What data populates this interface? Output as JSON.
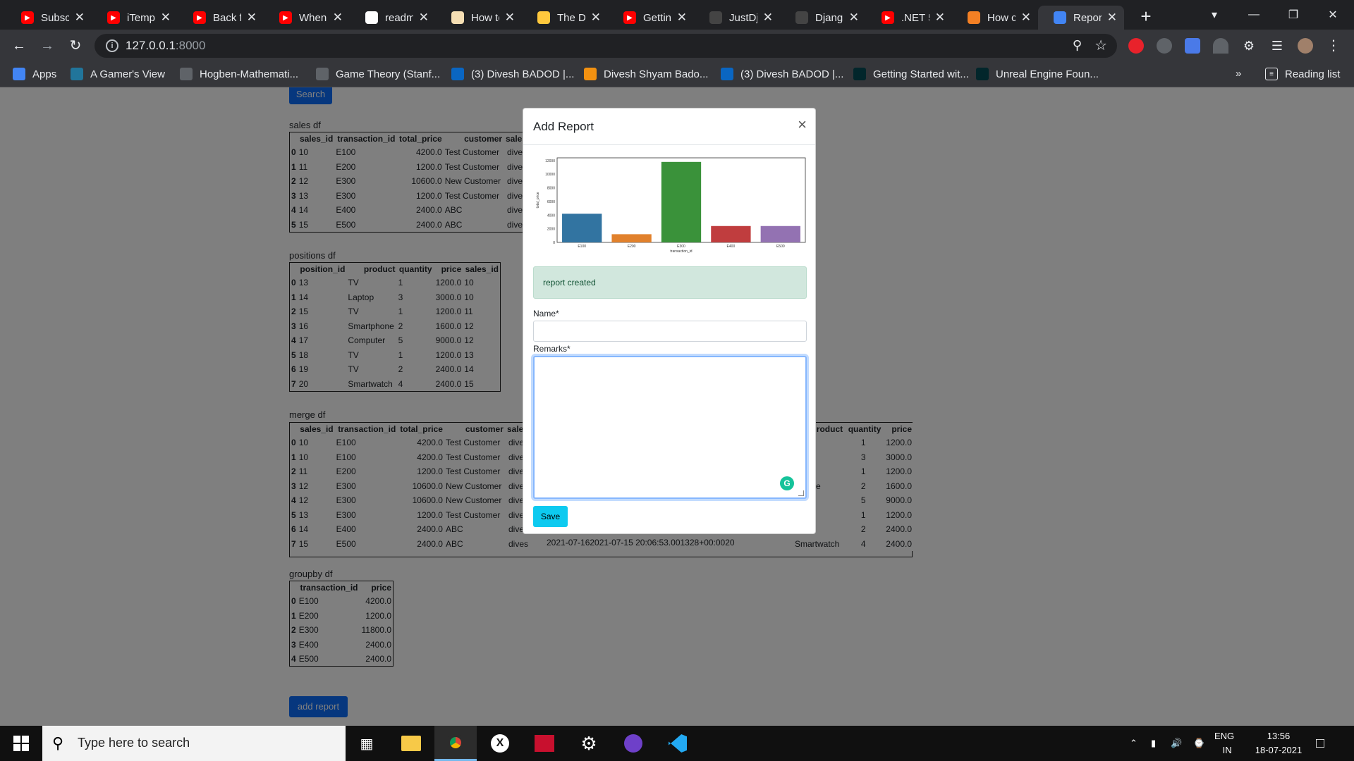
{
  "browser": {
    "tabs": [
      {
        "title": "Subscr",
        "icon": "youtube-icon",
        "color": "#ff0000"
      },
      {
        "title": "iTemp",
        "icon": "youtube-icon",
        "color": "#ff0000"
      },
      {
        "title": "Back fr",
        "icon": "youtube-icon",
        "color": "#ff0000"
      },
      {
        "title": "When",
        "icon": "youtube-icon",
        "color": "#ff0000"
      },
      {
        "title": "readm",
        "icon": "google-icon",
        "color": "#ffffff"
      },
      {
        "title": "How to",
        "icon": "howto-icon",
        "color": "#f5deb3"
      },
      {
        "title": "The D",
        "icon": "emoji-icon",
        "color": "#ffc83d"
      },
      {
        "title": "Gettin",
        "icon": "youtube-icon",
        "color": "#ff0000"
      },
      {
        "title": "JustDj",
        "icon": "github-icon",
        "color": "#444444"
      },
      {
        "title": "Djang",
        "icon": "github-icon",
        "color": "#444444"
      },
      {
        "title": ".NET 5",
        "icon": "youtube-icon",
        "color": "#ff0000"
      },
      {
        "title": "How c",
        "icon": "stackoverflow-icon",
        "color": "#f48024"
      },
      {
        "title": "Repor",
        "icon": "tab-logo-icon",
        "color": "#4285f4",
        "active": true
      }
    ],
    "url_host": "127.0.0.1",
    "url_port": ":8000",
    "bookmarks": [
      {
        "label": "Apps",
        "icon": "apps-grid-icon"
      },
      {
        "label": "A Gamer's View",
        "icon": "wordpress-icon"
      },
      {
        "label": "Hogben-Mathemati...",
        "icon": "library-icon"
      },
      {
        "label": "Game Theory (Stanf...",
        "icon": "coursera-icon"
      },
      {
        "label": "(3) Divesh BADOD |...",
        "icon": "linkedin-icon"
      },
      {
        "label": "Divesh Shyam Bado...",
        "icon": "profile-icon"
      },
      {
        "label": "(3) Divesh BADOD |...",
        "icon": "linkedin-icon"
      },
      {
        "label": "Getting Started wit...",
        "icon": "edx-icon"
      },
      {
        "label": "Unreal Engine Foun...",
        "icon": "edx-icon"
      }
    ],
    "bookmarks_overflow": "»",
    "reading_list": "Reading list"
  },
  "page": {
    "search_button": "Search",
    "sales_label": "sales df",
    "sales_table": {
      "headers": [
        "",
        "sales_id",
        "transaction_id",
        "total_price",
        "customer",
        "sales"
      ],
      "rows": [
        [
          "0",
          "10",
          "E100",
          "4200.0",
          "Test Customer",
          "dives"
        ],
        [
          "1",
          "11",
          "E200",
          "1200.0",
          "Test Customer",
          "dives"
        ],
        [
          "2",
          "12",
          "E300",
          "10600.0",
          "New Customer",
          "dives"
        ],
        [
          "3",
          "13",
          "E300",
          "1200.0",
          "Test Customer",
          "dives"
        ],
        [
          "4",
          "14",
          "E400",
          "2400.0",
          "ABC",
          "dives"
        ],
        [
          "5",
          "15",
          "E500",
          "2400.0",
          "ABC",
          "dives"
        ]
      ]
    },
    "positions_label": "positions df",
    "positions_table": {
      "headers": [
        "",
        "position_id",
        "product",
        "quantity",
        "price",
        "sales_id"
      ],
      "rows": [
        [
          "0",
          "13",
          "TV",
          "1",
          "1200.0",
          "10"
        ],
        [
          "1",
          "14",
          "Laptop",
          "3",
          "3000.0",
          "10"
        ],
        [
          "2",
          "15",
          "TV",
          "1",
          "1200.0",
          "11"
        ],
        [
          "3",
          "16",
          "Smartphone",
          "2",
          "1600.0",
          "12"
        ],
        [
          "4",
          "17",
          "Computer",
          "5",
          "9000.0",
          "12"
        ],
        [
          "5",
          "18",
          "TV",
          "1",
          "1200.0",
          "13"
        ],
        [
          "6",
          "19",
          "TV",
          "2",
          "2400.0",
          "14"
        ],
        [
          "7",
          "20",
          "Smartwatch",
          "4",
          "2400.0",
          "15"
        ]
      ]
    },
    "merge_label": "merge df",
    "merge_table": {
      "headers": [
        "",
        "sales_id",
        "transaction_id",
        "total_price",
        "customer",
        "sales"
      ],
      "rows": [
        [
          "0",
          "10",
          "E100",
          "4200.0",
          "Test Customer",
          "dives"
        ],
        [
          "1",
          "10",
          "E100",
          "4200.0",
          "Test Customer",
          "dives"
        ],
        [
          "2",
          "11",
          "E200",
          "1200.0",
          "Test Customer",
          "dives"
        ],
        [
          "3",
          "12",
          "E300",
          "10600.0",
          "New Customer",
          "dives"
        ],
        [
          "4",
          "12",
          "E300",
          "10600.0",
          "New Customer",
          "dives"
        ],
        [
          "5",
          "13",
          "E300",
          "1200.0",
          "Test Customer",
          "dives"
        ],
        [
          "6",
          "14",
          "E400",
          "2400.0",
          "ABC",
          "dives"
        ],
        [
          "7",
          "15",
          "E500",
          "2400.0",
          "ABC",
          "dives"
        ]
      ],
      "right_headers": [
        "roduct",
        "quantity",
        "price"
      ],
      "right_rows": [
        [
          "",
          "1",
          "1200.0"
        ],
        [
          "p",
          "3",
          "3000.0"
        ],
        [
          "",
          "1",
          "1200.0"
        ],
        [
          "tphone",
          "2",
          "1600.0"
        ],
        [
          "puter",
          "5",
          "9000.0"
        ],
        [
          "",
          "1",
          "1200.0"
        ],
        [
          "",
          "2",
          "2400.0"
        ],
        [
          "Smartwatch",
          "4",
          "2400.0"
        ]
      ],
      "last_row_middle": "2021-07-162021-07-15 20:06:53.001328+00:0020"
    },
    "groupby_label": "groupby df",
    "groupby_table": {
      "headers": [
        "",
        "transaction_id",
        "price"
      ],
      "rows": [
        [
          "0",
          "E100",
          "4200.0"
        ],
        [
          "1",
          "E200",
          "1200.0"
        ],
        [
          "2",
          "E300",
          "11800.0"
        ],
        [
          "3",
          "E400",
          "2400.0"
        ],
        [
          "4",
          "E500",
          "2400.0"
        ]
      ]
    },
    "add_report_button": "add report"
  },
  "modal": {
    "title": "Add Report",
    "close": "×",
    "alert": "report created",
    "name_label": "Name*",
    "name_value": "",
    "remarks_label": "Remarks*",
    "remarks_value": "",
    "save_button": "Save",
    "grammarly": "G"
  },
  "chart_data": {
    "type": "bar",
    "categories": [
      "E100",
      "E200",
      "E300",
      "E400",
      "E500"
    ],
    "values": [
      4200,
      1200,
      11800,
      2400,
      2400
    ],
    "colors": [
      "#3274a1",
      "#e1812c",
      "#3a923a",
      "#c03d3e",
      "#9372b2"
    ],
    "xlabel": "transaction_id",
    "ylabel": "total_price",
    "yticks": [
      0,
      2000,
      4000,
      6000,
      8000,
      10000,
      12000
    ],
    "ylim": [
      0,
      12400
    ]
  },
  "taskbar": {
    "search_placeholder": "Type here to search",
    "lang_top": "ENG",
    "lang_bottom": "IN",
    "time": "13:56",
    "date": "18-07-2021"
  }
}
